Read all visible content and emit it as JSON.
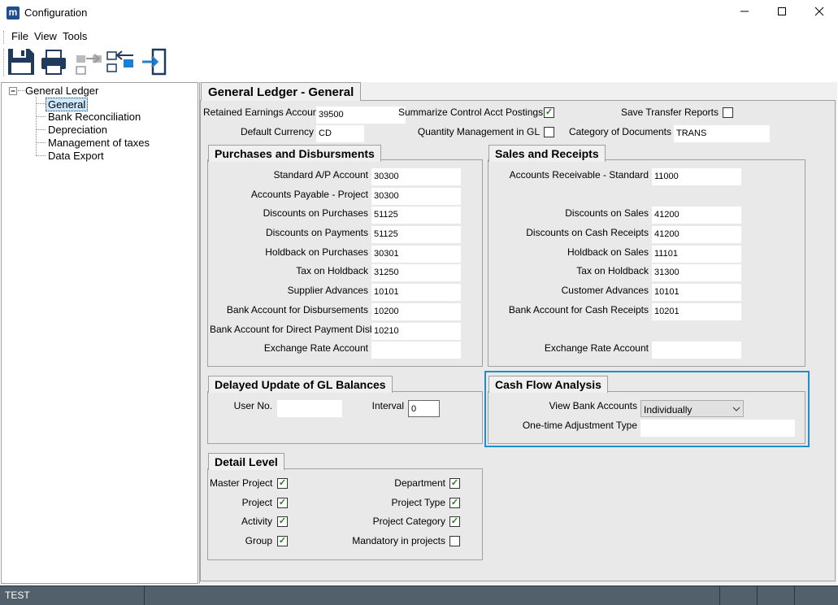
{
  "window": {
    "title": "Configuration",
    "app_icon": "m"
  },
  "menu": [
    "File",
    "View",
    "Tools"
  ],
  "toolbar": [
    "save-icon",
    "print-icon",
    "transfer-out-icon",
    "transfer-in-icon",
    "exit-icon"
  ],
  "tree": {
    "root": "General Ledger",
    "children": [
      "General",
      "Bank Reconciliation",
      "Depreciation",
      "Management of taxes",
      "Data Export"
    ],
    "selected": "General"
  },
  "main_tab": "General Ledger - General",
  "top": {
    "retained_label": "Retained Earnings Account",
    "retained_value": "39500",
    "summarize_label": "Summarize Control Acct Postings",
    "summarize_checked": true,
    "save_transfer_label": "Save Transfer Reports",
    "save_transfer_checked": false,
    "currency_label": "Default Currency",
    "currency_value": "CD",
    "qty_label": "Quantity Management in GL",
    "qty_checked": false,
    "category_label": "Category of Documents",
    "category_value": "TRANS"
  },
  "purchases": {
    "title": "Purchases and Disbursments",
    "rows": [
      {
        "label": "Standard A/P Account",
        "value": "30300"
      },
      {
        "label": "Accounts Payable - Project",
        "value": "30300"
      },
      {
        "label": "Discounts on Purchases",
        "value": "51125"
      },
      {
        "label": "Discounts on Payments",
        "value": "51125"
      },
      {
        "label": "Holdback on Purchases",
        "value": "30301"
      },
      {
        "label": "Tax on Holdback",
        "value": "31250"
      },
      {
        "label": "Supplier Advances",
        "value": "10101"
      },
      {
        "label": "Bank Account for Disbursements",
        "value": "10200"
      },
      {
        "label": "Bank Account for Direct Payment Disb.",
        "value": "10210"
      },
      {
        "label": "Exchange Rate Account",
        "value": ""
      }
    ]
  },
  "sales": {
    "title": "Sales and Receipts",
    "rows": [
      {
        "label": "Accounts Receivable - Standard",
        "value": "11000"
      },
      {
        "label": "Discounts on Sales",
        "value": "41200"
      },
      {
        "label": "Discounts on Cash Receipts",
        "value": "41200"
      },
      {
        "label": "Holdback on Sales",
        "value": "11101"
      },
      {
        "label": "Tax on Holdback",
        "value": "31300"
      },
      {
        "label": "Customer Advances",
        "value": "10101"
      },
      {
        "label": "Bank Account for Cash Receipts",
        "value": "10201"
      },
      {
        "label": "Exchange Rate Account",
        "value": ""
      }
    ]
  },
  "delayed": {
    "title": "Delayed Update of GL Balances",
    "user_label": "User No.",
    "user_value": "",
    "interval_label": "Interval",
    "interval_value": "0"
  },
  "cashflow": {
    "title": "Cash Flow Analysis",
    "view_label": "View Bank Accounts",
    "view_value": "Individually",
    "adj_label": "One-time Adjustment Type",
    "adj_value": ""
  },
  "detail": {
    "title": "Detail Level",
    "left": [
      {
        "label": "Master Project",
        "checked": true
      },
      {
        "label": "Project",
        "checked": true
      },
      {
        "label": "Activity",
        "checked": true
      },
      {
        "label": "Group",
        "checked": true
      }
    ],
    "right": [
      {
        "label": "Department",
        "checked": true
      },
      {
        "label": "Project Type",
        "checked": true
      },
      {
        "label": "Project Category",
        "checked": true
      },
      {
        "label": "Mandatory in projects",
        "checked": false
      }
    ]
  },
  "status": {
    "text": "TEST"
  },
  "colors": {
    "highlight": "#1e90c8",
    "statusbar": "#51606b",
    "check": "#1a7f1a",
    "tree_selected": "#cce8ff"
  }
}
